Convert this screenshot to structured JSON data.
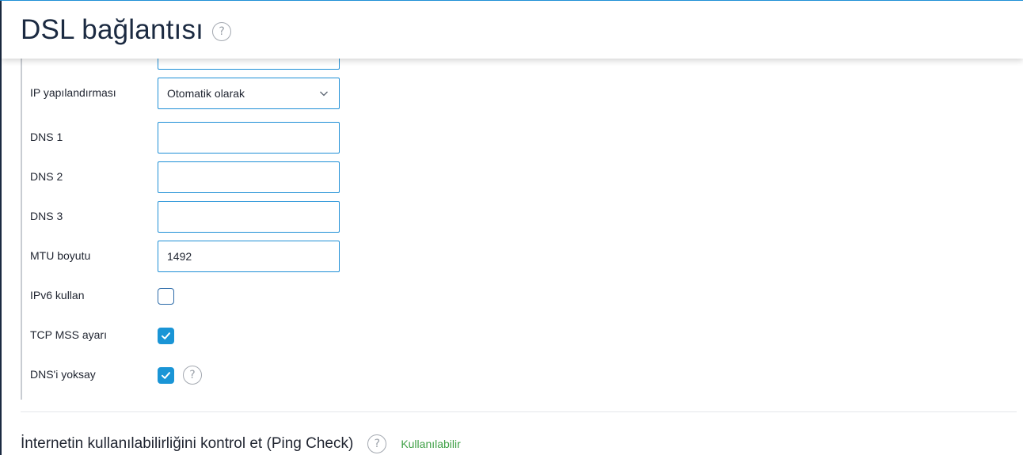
{
  "header": {
    "title": "DSL bağlantısı",
    "help_glyph": "?"
  },
  "form": {
    "ip_config": {
      "label": "IP yapılandırması",
      "value": "Otomatik olarak"
    },
    "dns1": {
      "label": "DNS 1",
      "value": ""
    },
    "dns2": {
      "label": "DNS 2",
      "value": ""
    },
    "dns3": {
      "label": "DNS 3",
      "value": ""
    },
    "mtu": {
      "label": "MTU boyutu",
      "value": "1492"
    },
    "ipv6": {
      "label": "IPv6 kullan",
      "checked": false
    },
    "tcp_mss": {
      "label": "TCP MSS ayarı",
      "checked": true
    },
    "ignore_dns": {
      "label": "DNS'i yoksay",
      "checked": true,
      "help_glyph": "?"
    }
  },
  "ping_check": {
    "title": "İnternetin kullanılabilirliğini kontrol et (Ping Check)",
    "help_glyph": "?",
    "status": "Kullanılabilir"
  },
  "colors": {
    "accent": "#1e8fd6",
    "checkbox_checked": "#1a95d6",
    "status_ok": "#3fa046",
    "title_text": "#1b2a41"
  },
  "icons": {
    "help": "question-circle-icon",
    "dropdown": "chevron-down-icon",
    "check": "checkmark-icon"
  }
}
